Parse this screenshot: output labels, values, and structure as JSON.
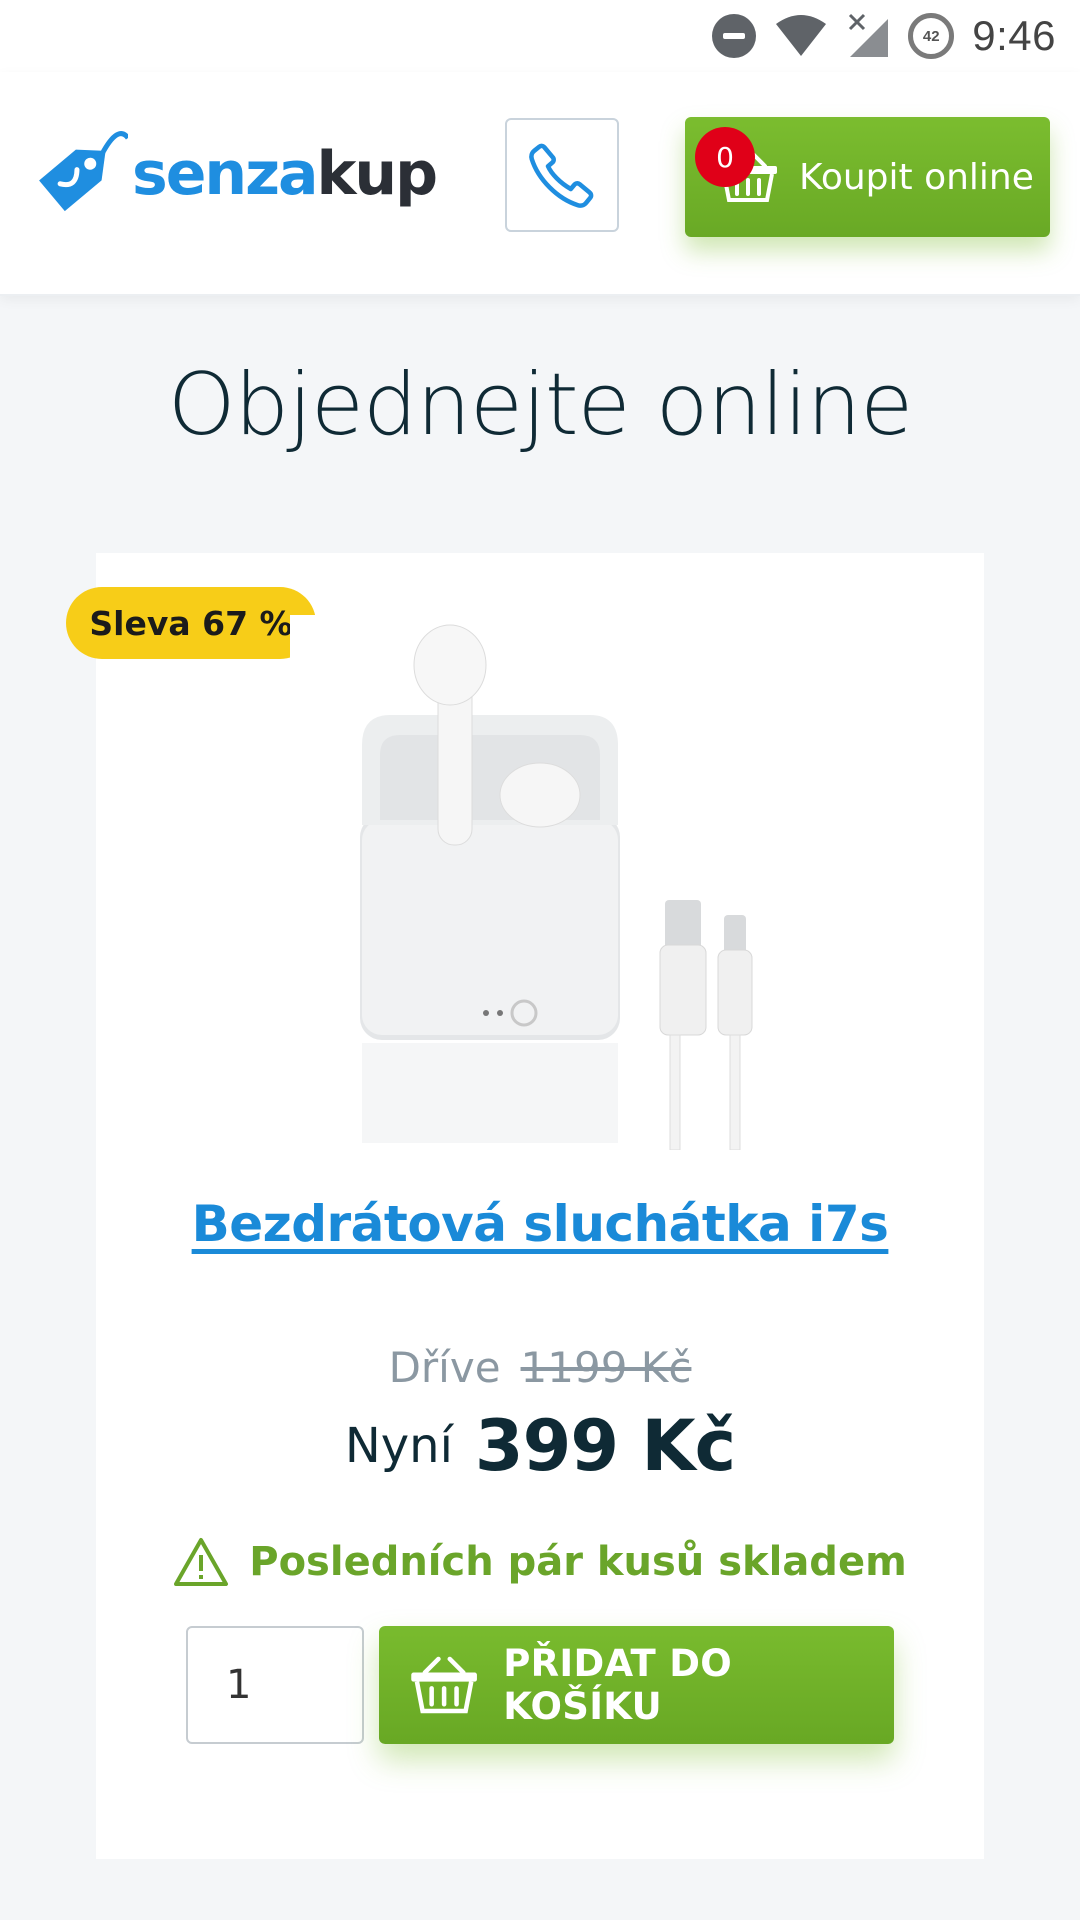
{
  "status_bar": {
    "time": "9:46",
    "battery_level": "42",
    "icons": [
      "do-not-disturb-icon",
      "wifi-icon",
      "signal-no-data-icon",
      "battery-icon"
    ]
  },
  "header": {
    "logo": {
      "part1": "senza",
      "part2": "kup"
    },
    "phone_button_icon": "phone-icon",
    "buy_button": {
      "label": "Koupit online",
      "cart_count": "0"
    }
  },
  "page": {
    "title": "Objednejte online"
  },
  "product": {
    "discount_badge": "Sleva 67 %",
    "name": "Bezdrátová sluchátka i7s",
    "old_price_label": "Dříve",
    "old_price": "1199 Kč",
    "current_price_label": "Nyní",
    "current_price": "399 Kč",
    "stock_notice": "Posledních pár kusů skladem",
    "quantity": "1",
    "add_to_cart_label": "PŘIDAT DO KOŠÍKU"
  },
  "colors": {
    "brand_blue": "#1f8ee0",
    "accent_green": "#72b52a",
    "badge_yellow": "#f7cd18",
    "badge_red": "#e00018"
  }
}
